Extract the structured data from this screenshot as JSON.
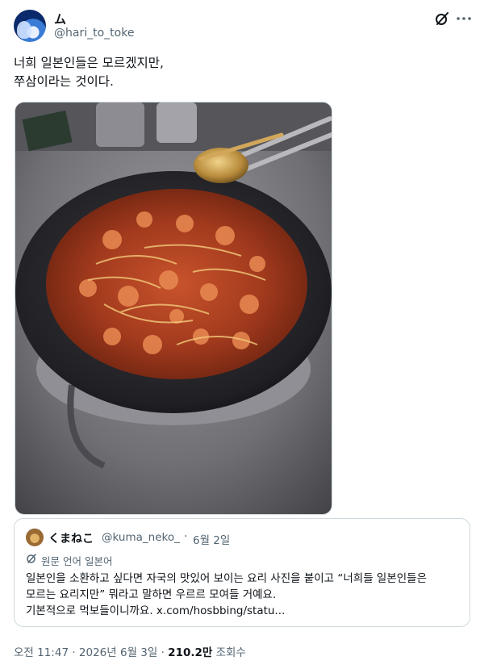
{
  "author": {
    "name": "ム",
    "handle": "@hari_to_toke"
  },
  "tweet": {
    "line1": "너희 일본인들은 모르겠지만,",
    "line2": "쭈삼이라는 것이다."
  },
  "quote": {
    "name": "くまねこ",
    "handle": "@kuma_neko_",
    "dot": "·",
    "date": "6월 2일",
    "translate_label": "원문 언어 일본어",
    "line1": "일본인을 소환하고 싶다면 자국의 맛있어 보이는 요리 사진을 붙이고 “너희들 일본인들은",
    "line2": "모르는 요리지만” 뭐라고 말하면 우르르 모여들 거예요.",
    "line3": "기본적으로 먹보들이니까요. x.com/hosbbing/statu..."
  },
  "meta": {
    "time_date": "오전 11:47 · 2026년 6월 3일 · ",
    "views": "210.2만",
    "views_label": " 조회수"
  },
  "icons": {
    "grok": "grok-icon",
    "more": "more-icon",
    "translate": "translate-icon"
  },
  "colors": {
    "text": "#0f1419",
    "secondary": "#536471",
    "border": "#cfd9de"
  }
}
